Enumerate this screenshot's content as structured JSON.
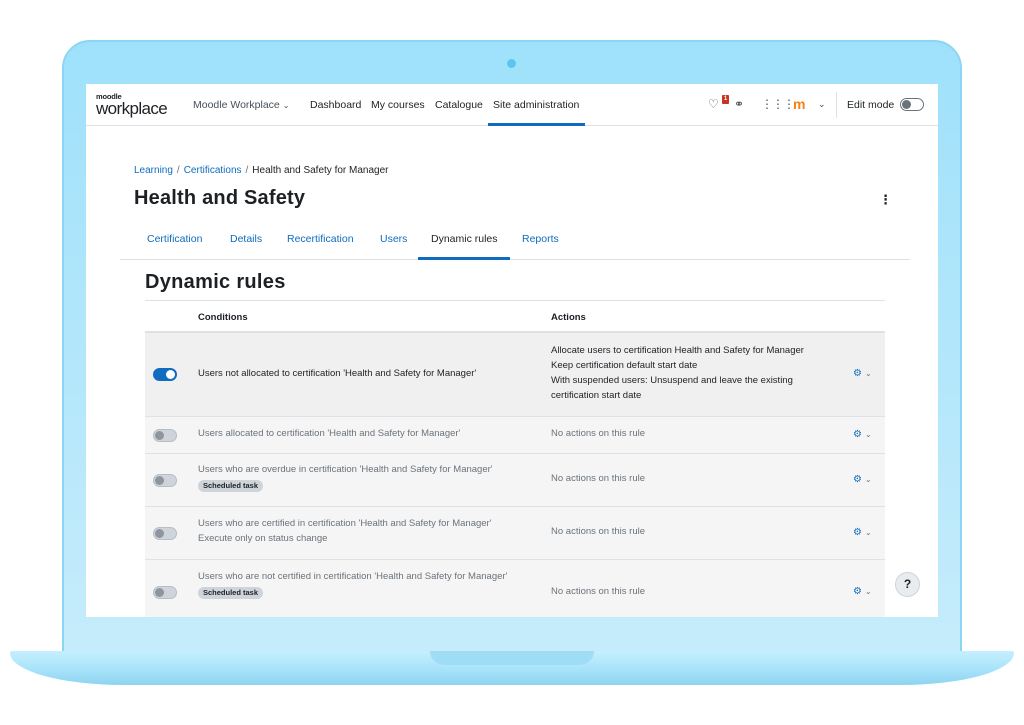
{
  "navbar": {
    "logo_small": "moodle",
    "logo_big": "workplace",
    "tenant_label": "Moodle Workplace",
    "links": [
      "Dashboard",
      "My courses",
      "Catalogue",
      "Site administration"
    ],
    "active_link": "Site administration",
    "notification_count": "1",
    "avatar_letter": "m",
    "edit_mode_label": "Edit mode",
    "edit_mode_on": false
  },
  "breadcrumb": {
    "items": [
      "Learning",
      "Certifications",
      "Health and Safety for Manager"
    ]
  },
  "page_title": "Health and Safety",
  "tabs": [
    "Certification",
    "Details",
    "Recertification",
    "Users",
    "Dynamic rules",
    "Reports"
  ],
  "active_tab": "Dynamic rules",
  "section_title": "Dynamic rules",
  "table": {
    "headers": {
      "conditions": "Conditions",
      "actions": "Actions"
    },
    "rows": [
      {
        "enabled": true,
        "conditions": [
          "Users not allocated to certification 'Health and Safety for Manager'"
        ],
        "badge": "",
        "actions": [
          "Allocate users to certification Health and Safety for Manager",
          "Keep certification default start date",
          "With suspended users: Unsuspend and leave the existing certification start date"
        ]
      },
      {
        "enabled": false,
        "conditions": [
          "Users allocated to certification 'Health and Safety for Manager'"
        ],
        "badge": "",
        "actions": [
          "No actions on this rule"
        ]
      },
      {
        "enabled": false,
        "conditions": [
          "Users who are overdue in certification 'Health and Safety for Manager'"
        ],
        "badge": "Scheduled task",
        "actions": [
          "No actions on this rule"
        ]
      },
      {
        "enabled": false,
        "conditions": [
          "Users who are certified in certification 'Health and Safety for Manager'",
          "Execute only on status change"
        ],
        "badge": "",
        "actions": [
          "No actions on this rule"
        ]
      },
      {
        "enabled": false,
        "conditions": [
          "Users who are not certified in certification 'Health and Safety for Manager'"
        ],
        "badge": "Scheduled task",
        "actions": [
          "No actions on this rule"
        ]
      }
    ]
  },
  "help_label": "?",
  "colors": {
    "brand_blue": "#0f6cbf",
    "moodle_orange": "#f98012",
    "frame": "#9fe1fb"
  }
}
